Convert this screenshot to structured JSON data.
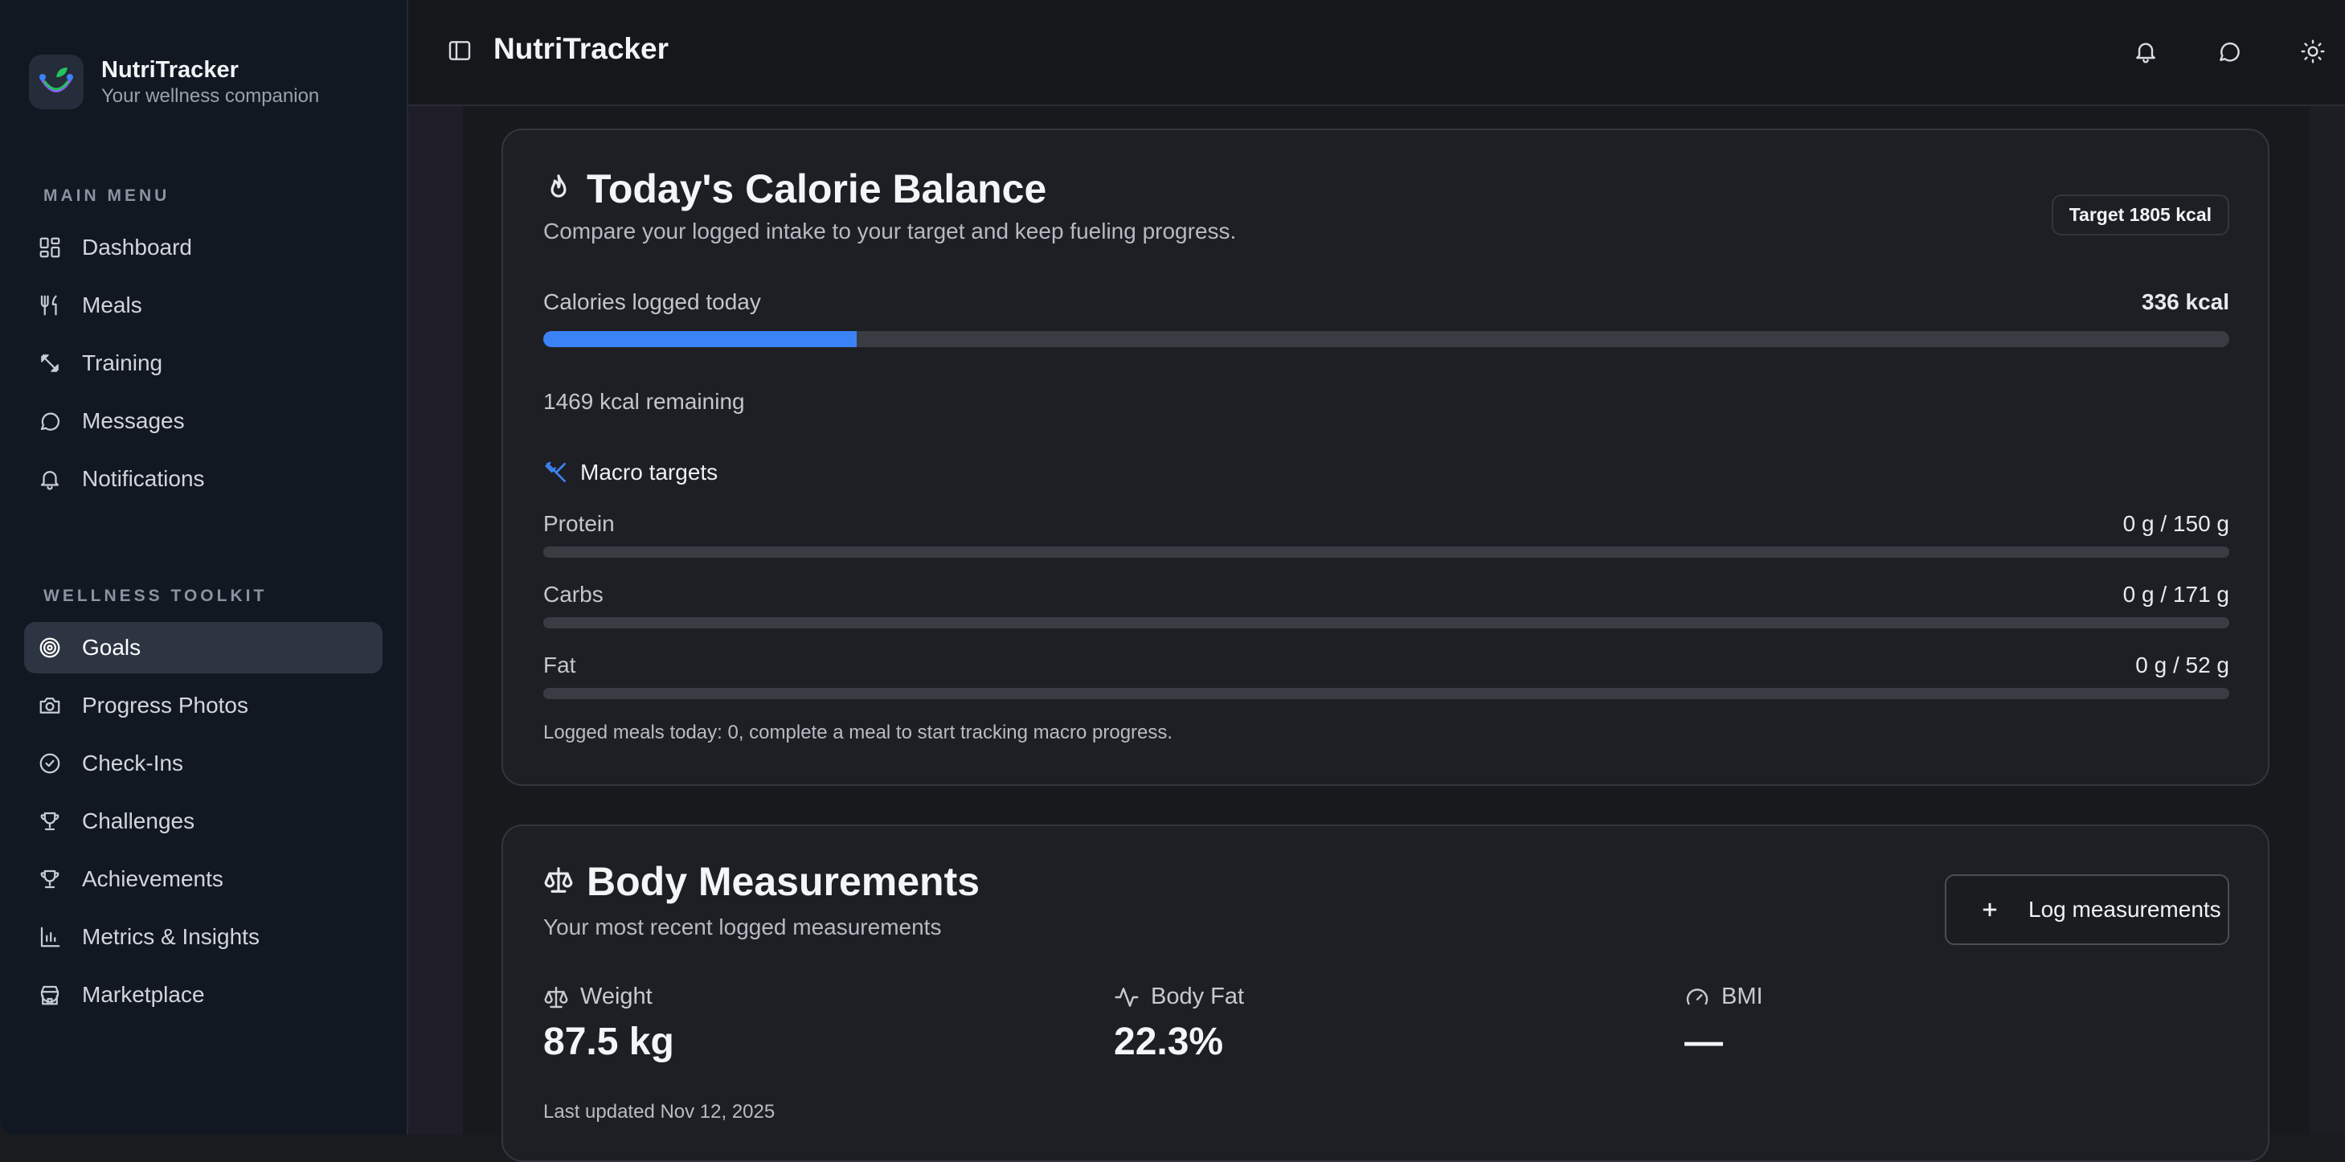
{
  "app": {
    "name": "NutriTracker",
    "tagline": "Your wellness companion"
  },
  "header": {
    "title": "NutriTracker"
  },
  "sidebar": {
    "main_label": "MAIN MENU",
    "main_items": [
      {
        "label": "Dashboard",
        "icon": "dashboard-icon"
      },
      {
        "label": "Meals",
        "icon": "utensils-icon"
      },
      {
        "label": "Training",
        "icon": "dumbbell-icon"
      },
      {
        "label": "Messages",
        "icon": "message-icon"
      },
      {
        "label": "Notifications",
        "icon": "bell-icon"
      }
    ],
    "toolkit_label": "WELLNESS TOOLKIT",
    "toolkit_items": [
      {
        "label": "Goals",
        "icon": "target-icon",
        "active": true
      },
      {
        "label": "Progress Photos",
        "icon": "camera-icon"
      },
      {
        "label": "Check-Ins",
        "icon": "check-circle-icon"
      },
      {
        "label": "Challenges",
        "icon": "trophy-icon"
      },
      {
        "label": "Achievements",
        "icon": "trophy-icon"
      },
      {
        "label": "Metrics & Insights",
        "icon": "bar-chart-icon"
      },
      {
        "label": "Marketplace",
        "icon": "store-icon"
      }
    ]
  },
  "calorie_card": {
    "title": "Today's Calorie Balance",
    "subtitle": "Compare your logged intake to your target and keep fueling progress.",
    "target_badge": "Target 1805 kcal",
    "logged_label": "Calories logged today",
    "logged_value": "336 kcal",
    "progress_fraction": 0.186,
    "remaining": "1469 kcal remaining",
    "macro_heading": "Macro targets",
    "macros": [
      {
        "label": "Protein",
        "value": "0 g / 150 g",
        "fraction": 0
      },
      {
        "label": "Carbs",
        "value": "0 g / 171 g",
        "fraction": 0
      },
      {
        "label": "Fat",
        "value": "0 g / 52 g",
        "fraction": 0
      }
    ],
    "note": "Logged meals today: 0, complete a meal to start tracking macro progress."
  },
  "measure_card": {
    "title": "Body Measurements",
    "subtitle": "Your most recent logged measurements",
    "log_button": "Log measurements",
    "metrics": [
      {
        "label": "Weight",
        "value": "87.5 kg",
        "icon": "scale-icon"
      },
      {
        "label": "Body Fat",
        "value": "22.3%",
        "icon": "activity-icon"
      },
      {
        "label": "BMI",
        "value": "—",
        "icon": "gauge-icon"
      }
    ],
    "updated": "Last updated Nov 12, 2025"
  },
  "colors": {
    "accent": "#3b82f6",
    "sidebar_bg": "#121822",
    "active_bg": "#2d3542"
  }
}
